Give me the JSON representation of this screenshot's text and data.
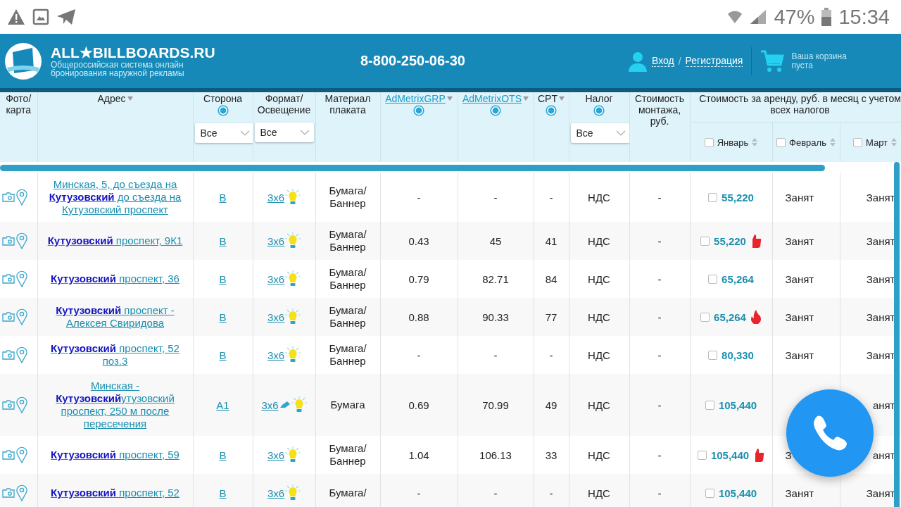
{
  "status_bar": {
    "battery_text": "47%",
    "time": "15:34"
  },
  "header": {
    "brand": "ALL★BILLBOARDS.RU",
    "tagline": [
      "Общероссийская система онлайн",
      "бронирования наружной рекламы"
    ],
    "phone": "8-800-250-06-30",
    "login": "Вход",
    "separator": "/",
    "register": "Регистрация",
    "cart": [
      "Ваша корзина",
      "пуста"
    ]
  },
  "table": {
    "columns": [
      {
        "label": "Фото/ карта",
        "link": false,
        "sort": false,
        "help": false
      },
      {
        "label": "Адрес",
        "link": false,
        "sort": true,
        "help": false
      },
      {
        "label": "Сторона",
        "link": false,
        "sort": false,
        "help": true,
        "select": "Все"
      },
      {
        "label": "Формат/ Освещение",
        "link": false,
        "sort": false,
        "help": false,
        "select": "Все"
      },
      {
        "label": "Материал плаката",
        "link": false,
        "sort": false,
        "help": false
      },
      {
        "label": "AdMetrixGRP",
        "link": true,
        "sort": true,
        "help": true
      },
      {
        "label": "AdMetrixOTS",
        "link": true,
        "sort": true,
        "help": true
      },
      {
        "label": "CPT",
        "link": false,
        "sort": true,
        "help": true
      },
      {
        "label": "Налог",
        "link": false,
        "sort": false,
        "help": true,
        "select": "Все"
      },
      {
        "label": "Стоимость монтажа, руб.",
        "link": false,
        "sort": false,
        "help": false
      }
    ],
    "rent_header": "Стоимость за аренду, руб. в месяц с учетом всех налогов",
    "months": [
      {
        "label": "Январь",
        "checked": false
      },
      {
        "label": "Февраль",
        "checked": false
      },
      {
        "label": "Март",
        "checked": false
      }
    ],
    "rows": [
      {
        "address": "Минская, 5, до съезда на **Кутузовский** до съезда на Кутузовский проспект",
        "side": "В",
        "format": "3x6",
        "edit": false,
        "material": "Бумага/ Баннер",
        "grp": "-",
        "ots": "-",
        "cpt": "-",
        "tax": "НДС",
        "mount": "-",
        "checked": false,
        "price": "55,220",
        "like": false,
        "hot": false,
        "feb": "Занят",
        "mar": "Занят"
      },
      {
        "address": "**Кутузовский** проспект, 9К1",
        "side": "В",
        "format": "3x6",
        "edit": false,
        "material": "Бумага/ Баннер",
        "grp": "0.43",
        "ots": "45",
        "cpt": "41",
        "tax": "НДС",
        "mount": "-",
        "checked": false,
        "price": "55,220",
        "like": true,
        "hot": false,
        "feb": "Занят",
        "mar": "Занят"
      },
      {
        "address": "**Кутузовский** проспект, 36",
        "side": "В",
        "format": "3x6",
        "edit": false,
        "material": "Бумага/ Баннер",
        "grp": "0.79",
        "ots": "82.71",
        "cpt": "84",
        "tax": "НДС",
        "mount": "-",
        "checked": false,
        "price": "65,264",
        "like": false,
        "hot": false,
        "feb": "Занят",
        "mar": "Занят"
      },
      {
        "address": "**Кутузовский** проспект - Алексея Свиридова",
        "side": "В",
        "format": "3x6",
        "edit": false,
        "material": "Бумага/ Баннер",
        "grp": "0.88",
        "ots": "90.33",
        "cpt": "77",
        "tax": "НДС",
        "mount": "-",
        "checked": false,
        "price": "65,264",
        "like": false,
        "hot": true,
        "feb": "Занят",
        "mar": "Занят"
      },
      {
        "address": "**Кутузовский** проспект, 52 поз.3",
        "side": "В",
        "format": "3x6",
        "edit": false,
        "material": "Бумага/ Баннер",
        "grp": "-",
        "ots": "-",
        "cpt": "-",
        "tax": "НДС",
        "mount": "-",
        "checked": false,
        "price": "80,330",
        "like": false,
        "hot": false,
        "feb": "Занят",
        "mar": "Занят"
      },
      {
        "address": "Минская - **Кутузовский**утузовский проспект, 250 м после пересечения",
        "side": "А1",
        "format": "3x6",
        "edit": true,
        "material": "Бумага",
        "grp": "0.69",
        "ots": "70.99",
        "cpt": "49",
        "tax": "НДС",
        "mount": "-",
        "checked": false,
        "price": "105,440",
        "like": false,
        "hot": false,
        "mar": "анят"
      },
      {
        "address": "**Кутузовский** проспект, 59",
        "side": "В",
        "format": "3x6",
        "edit": false,
        "material": "Бумага/ Баннер",
        "grp": "1.04",
        "ots": "106.13",
        "cpt": "33",
        "tax": "НДС",
        "mount": "-",
        "checked": false,
        "price": "105,440",
        "like": true,
        "hot": false,
        "feb": "З",
        "mar": "анят"
      },
      {
        "address": "**Кутузовский** проспект, 52",
        "side": "В",
        "format": "3x6",
        "edit": false,
        "material": "Бумага/",
        "grp": "-",
        "ots": "-",
        "cpt": "-",
        "tax": "НДС",
        "mount": "-",
        "checked": false,
        "price": "105,440",
        "like": false,
        "hot": false,
        "feb": "Занят",
        "mar": "Занят"
      }
    ]
  }
}
